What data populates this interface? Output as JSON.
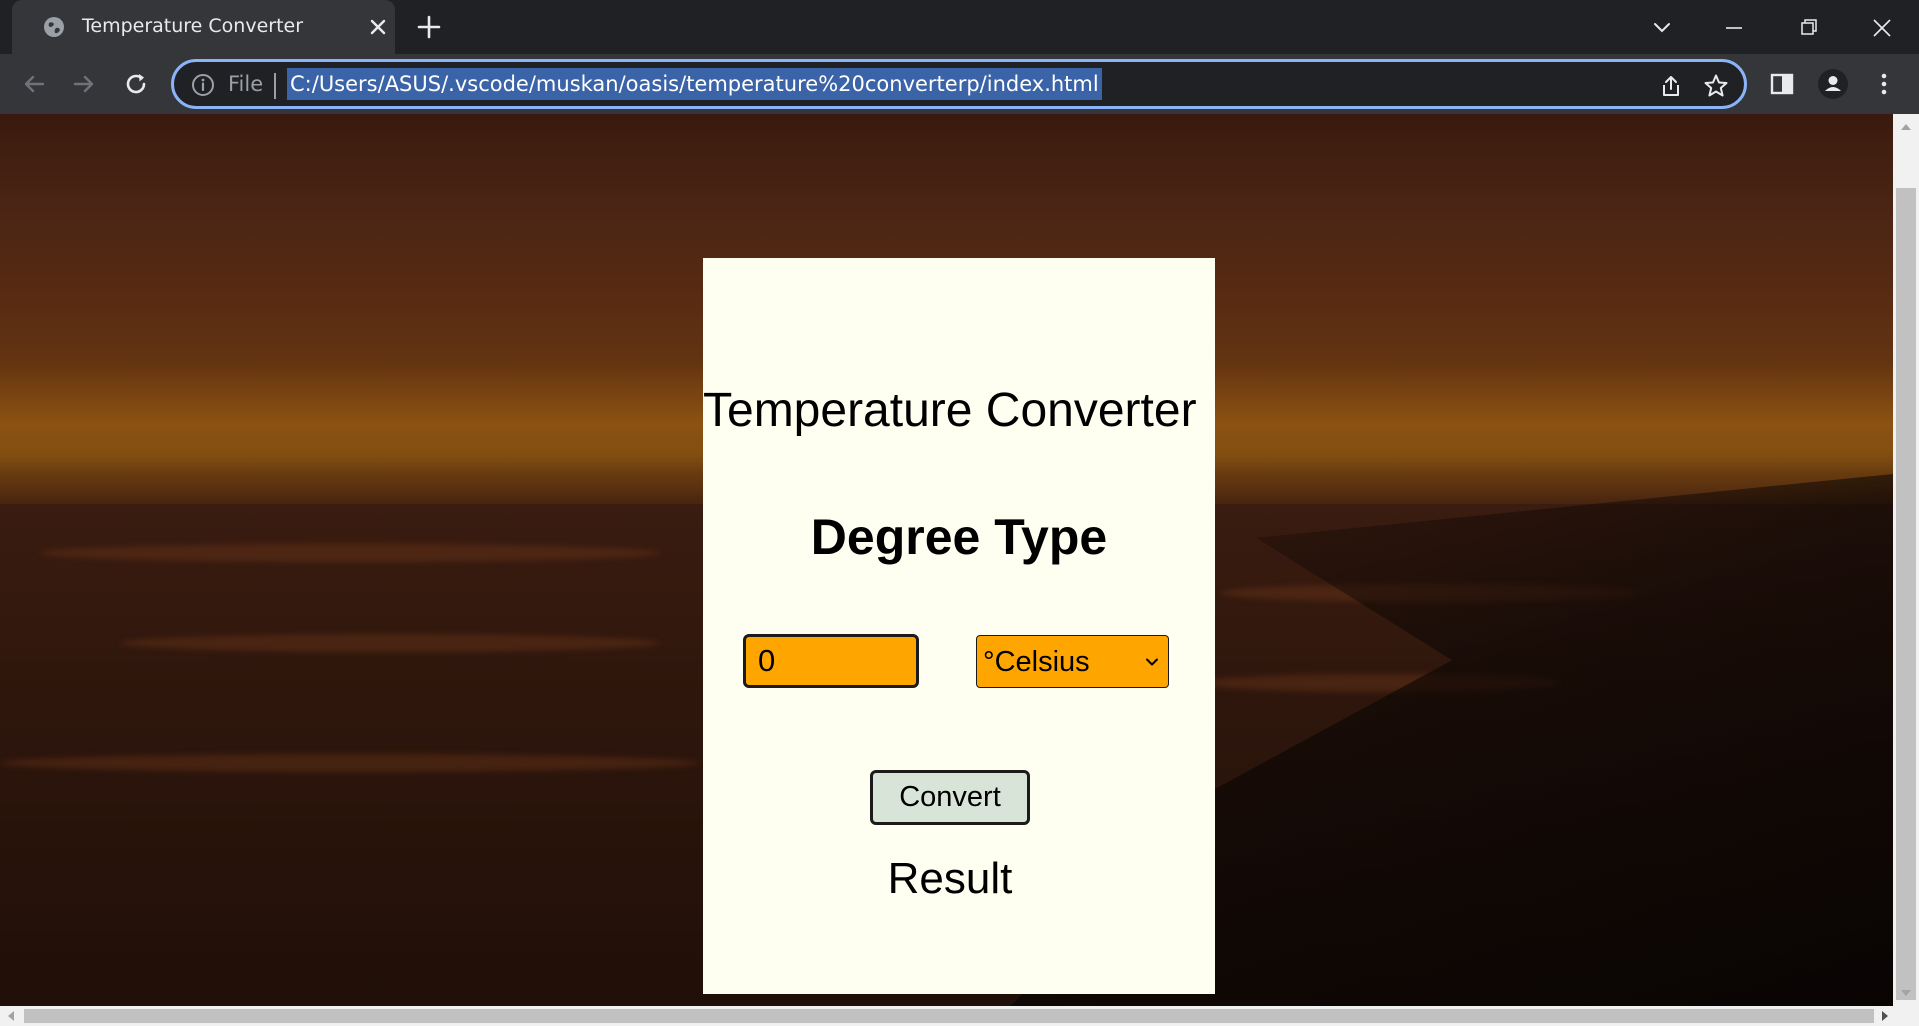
{
  "browser": {
    "tab": {
      "title": "Temperature Converter",
      "favicon": "globe-icon"
    },
    "address_bar": {
      "scheme_label": "File",
      "url": "C:/Users/ASUS/.vscode/muskan/oasis/temperature%20converterp/index.html"
    },
    "accent_color": "#8ab4f8"
  },
  "page": {
    "card": {
      "title": "Temperature Converter",
      "subtitle": "Degree Type",
      "input_value": "0",
      "unit_selected": "°Celsius",
      "convert_label": "Convert",
      "result_label": "Result",
      "colors": {
        "card_background": "#fffff1",
        "input_background": "#ffa500",
        "button_background": "#d8e4d8"
      }
    }
  }
}
